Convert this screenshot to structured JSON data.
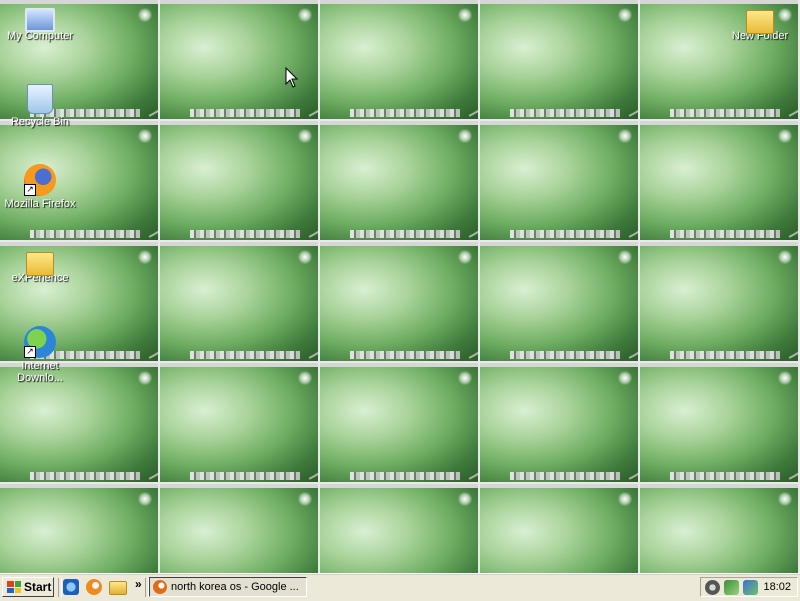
{
  "desktop": {
    "icons": [
      {
        "label": "My Computer",
        "icon": "computer-icon"
      },
      {
        "label": "Recycle Bin",
        "icon": "recycle-bin-icon"
      },
      {
        "label": "Mozilla Firefox",
        "icon": "firefox-icon"
      },
      {
        "label": "eXPerience",
        "icon": "folder-icon"
      },
      {
        "label": "Internet Downlo...",
        "icon": "internet-download-manager-icon"
      },
      {
        "label": "New Folder",
        "icon": "folder-icon"
      }
    ]
  },
  "taskbar": {
    "start_label": "Start",
    "quick_launch": [
      "internet-explorer-icon",
      "firefox-icon",
      "folder-icon"
    ],
    "chevron": "»",
    "task": {
      "label": "north korea os - Google ...",
      "icon": "firefox-icon"
    },
    "tray": {
      "icons": [
        "speaker-icon",
        "network-icon",
        "network-connection-icon"
      ],
      "clock": "18:02"
    }
  },
  "colors": {
    "taskbar": "#ece9d8",
    "selection": "#316ac5",
    "wallpaper": "#6fae63"
  }
}
